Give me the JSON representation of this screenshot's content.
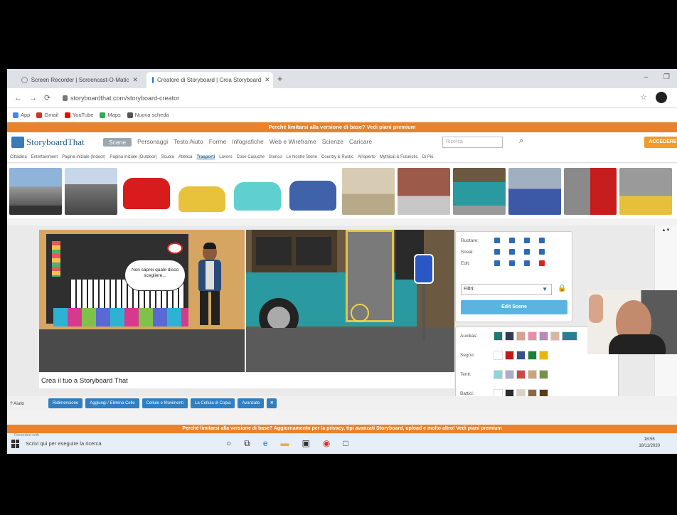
{
  "browser": {
    "tabs": [
      {
        "title": "Screen Recorder | Screencast-O-Matic",
        "active": false
      },
      {
        "title": "Creatore di Storyboard | Crea Storyboard",
        "active": true
      }
    ],
    "new_tab_label": "+",
    "window_controls": [
      "–",
      "❐",
      "✕"
    ],
    "url": "storyboardthat.com/storyboard-creator",
    "bookmarks": [
      {
        "label": "App",
        "color": "#4285f4"
      },
      {
        "label": "Gmail",
        "color": "#d93025"
      },
      {
        "label": "YouTube",
        "color": "#ff0000"
      },
      {
        "label": "Maps",
        "color": "#34a853"
      },
      {
        "label": "Nuova scheda",
        "color": "#555555"
      }
    ]
  },
  "site": {
    "promo_top": "Perché limitarsi alla versione di base? Vedi piani premium",
    "logo": "StoryboardThat",
    "nav": [
      "Scene",
      "Personaggi",
      "Testo Aiuto",
      "Forme",
      "Infografiche",
      "Web e Wireframe",
      "Scienze",
      "Caricare"
    ],
    "search_placeholder": "Ricerca",
    "login": "ACCEDERE",
    "categories": [
      "Cittadina",
      "Entertainment",
      "Pagina iniziale (Indoor)",
      "Pagina iniziale (Outdoor)",
      "Scuola",
      "Atletica",
      "Trasporti",
      "Lavoro",
      "Cose Casuche",
      "Storico",
      "Le Nostre Storie",
      "Country & Rustic",
      "All'aperto",
      "Mythical & Futuristic",
      "Di Più"
    ],
    "selected_category": "Trasporti",
    "thumbnails": [
      "city-street",
      "road",
      "red-car",
      "yellow-car",
      "teal-car",
      "blue-car",
      "car-interior",
      "bus-stop",
      "bus-exterior",
      "bus-interior",
      "train-platform",
      "train-station"
    ]
  },
  "editor": {
    "speech_bubble": "Non saprei quale disco scegliere...",
    "storyboard_title": "Crea il tuo a Storyboard That",
    "tools": {
      "rows": [
        "Ruotare:",
        "Sceai:",
        "Edit:"
      ],
      "filter_label": "Filtri:",
      "edit_scene": "Edit Scene"
    },
    "colors": {
      "rows": [
        {
          "label": "Auxilias:",
          "swatches": [
            "#1b7a74",
            "#2d3e50",
            "#d9a08b",
            "#e58fa8",
            "#b98ab8",
            "#d8b6a3",
            "#2a7d8f"
          ]
        },
        {
          "label": "Segno:",
          "swatches": [
            "#ffffff",
            "#c21818",
            "#3b4d8a",
            "#18803a",
            "#e6b800"
          ]
        },
        {
          "label": "Tenti:",
          "swatches": [
            "#8fd3d9",
            "#b0aac8",
            "#c94848",
            "#c9a67a",
            "#7a8f4a"
          ]
        },
        {
          "label": "Battici:",
          "swatches": [
            "#ffffff",
            "#2a2a2a",
            "#d9d0c4",
            "#8a6a4a",
            "#5a3a1a"
          ]
        }
      ]
    },
    "scroll_arrows": "▲▼"
  },
  "toolbar": {
    "help": "? Aiuto",
    "buttons": [
      "Ridimensione",
      "Aggiungi / Elimina Celle",
      "Cellule e Movimenti",
      "La Cellula di Copia",
      "Avanzate"
    ]
  },
  "footer": {
    "promo_bottom": "Perché limitarsi alla versione di base? Aggiornamento per la privacy, tipi avanzati Storyboard, upload e molto altro! Vedi piani premium"
  },
  "taskbar": {
    "search_text": "Scrivi qui per eseguire la ricerca",
    "recorder": "Recorded with",
    "time": "18:55",
    "date": "18/11/2020"
  }
}
